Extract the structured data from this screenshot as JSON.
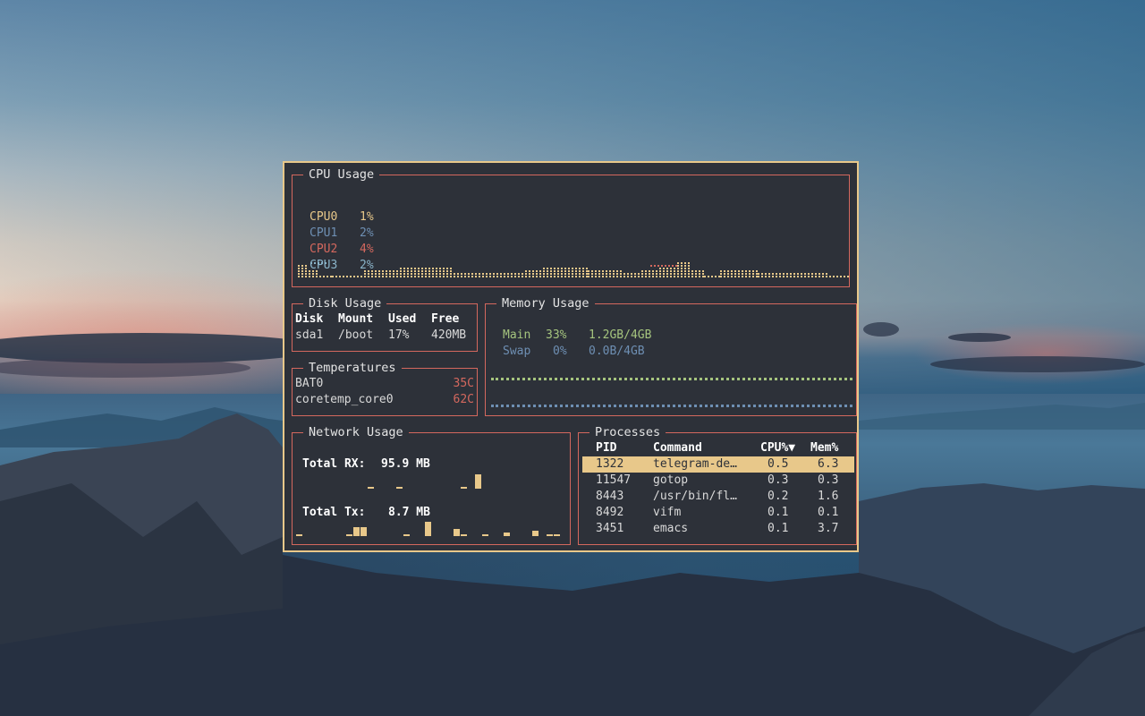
{
  "colors": {
    "window_border": "#e8c88a",
    "panel_border": "#d4685e",
    "background": "#2d3139",
    "cpu0": "#e8c88a",
    "cpu1": "#6e8fb3",
    "cpu2": "#d4685e",
    "cpu3": "#8ab4c9",
    "mem_main": "#a5c47e",
    "mem_swap": "#6e8fb3",
    "selected_row": "#e8c88a",
    "temperature": "#d4685e"
  },
  "cpu": {
    "title": "CPU Usage",
    "cores": [
      {
        "name": "CPU0",
        "usage": "1%"
      },
      {
        "name": "CPU1",
        "usage": "2%"
      },
      {
        "name": "CPU2",
        "usage": "4%"
      },
      {
        "name": "CPU3",
        "usage": "2%"
      }
    ]
  },
  "disk": {
    "title": "Disk Usage",
    "headers": [
      "Disk",
      "Mount",
      "Used",
      "Free"
    ],
    "rows": [
      [
        "sda1",
        "/boot",
        "17%",
        "420MB"
      ]
    ]
  },
  "memory": {
    "title": "Memory Usage",
    "rows": [
      {
        "name": "Main",
        "percent": "33%",
        "amount": "1.2GB/4GB"
      },
      {
        "name": "Swap",
        "percent": "0%",
        "amount": "0.0B/4GB"
      }
    ]
  },
  "temperatures": {
    "title": "Temperatures",
    "rows": [
      {
        "sensor": "BAT0",
        "value": "35C"
      },
      {
        "sensor": "coretemp_core0",
        "value": "62C"
      }
    ]
  },
  "network": {
    "title": "Network Usage",
    "rx_label": "Total RX:",
    "rx_value": "95.9 MB",
    "tx_label": "Total Tx:",
    "tx_value": "8.7 MB"
  },
  "processes": {
    "title": "Processes",
    "headers": {
      "pid": "PID",
      "command": "Command",
      "cpu": "CPU%▼",
      "mem": "Mem%"
    },
    "rows": [
      {
        "pid": "1322",
        "command": "telegram-de…",
        "cpu": "0.5",
        "mem": "6.3"
      },
      {
        "pid": "11547",
        "command": "gotop",
        "cpu": "0.3",
        "mem": "0.3"
      },
      {
        "pid": "8443",
        "command": "/usr/bin/fl…",
        "cpu": "0.2",
        "mem": "1.6"
      },
      {
        "pid": "8492",
        "command": "vifm",
        "cpu": "0.1",
        "mem": "0.1"
      },
      {
        "pid": "3451",
        "command": "emacs",
        "cpu": "0.1",
        "mem": "3.7"
      }
    ]
  }
}
